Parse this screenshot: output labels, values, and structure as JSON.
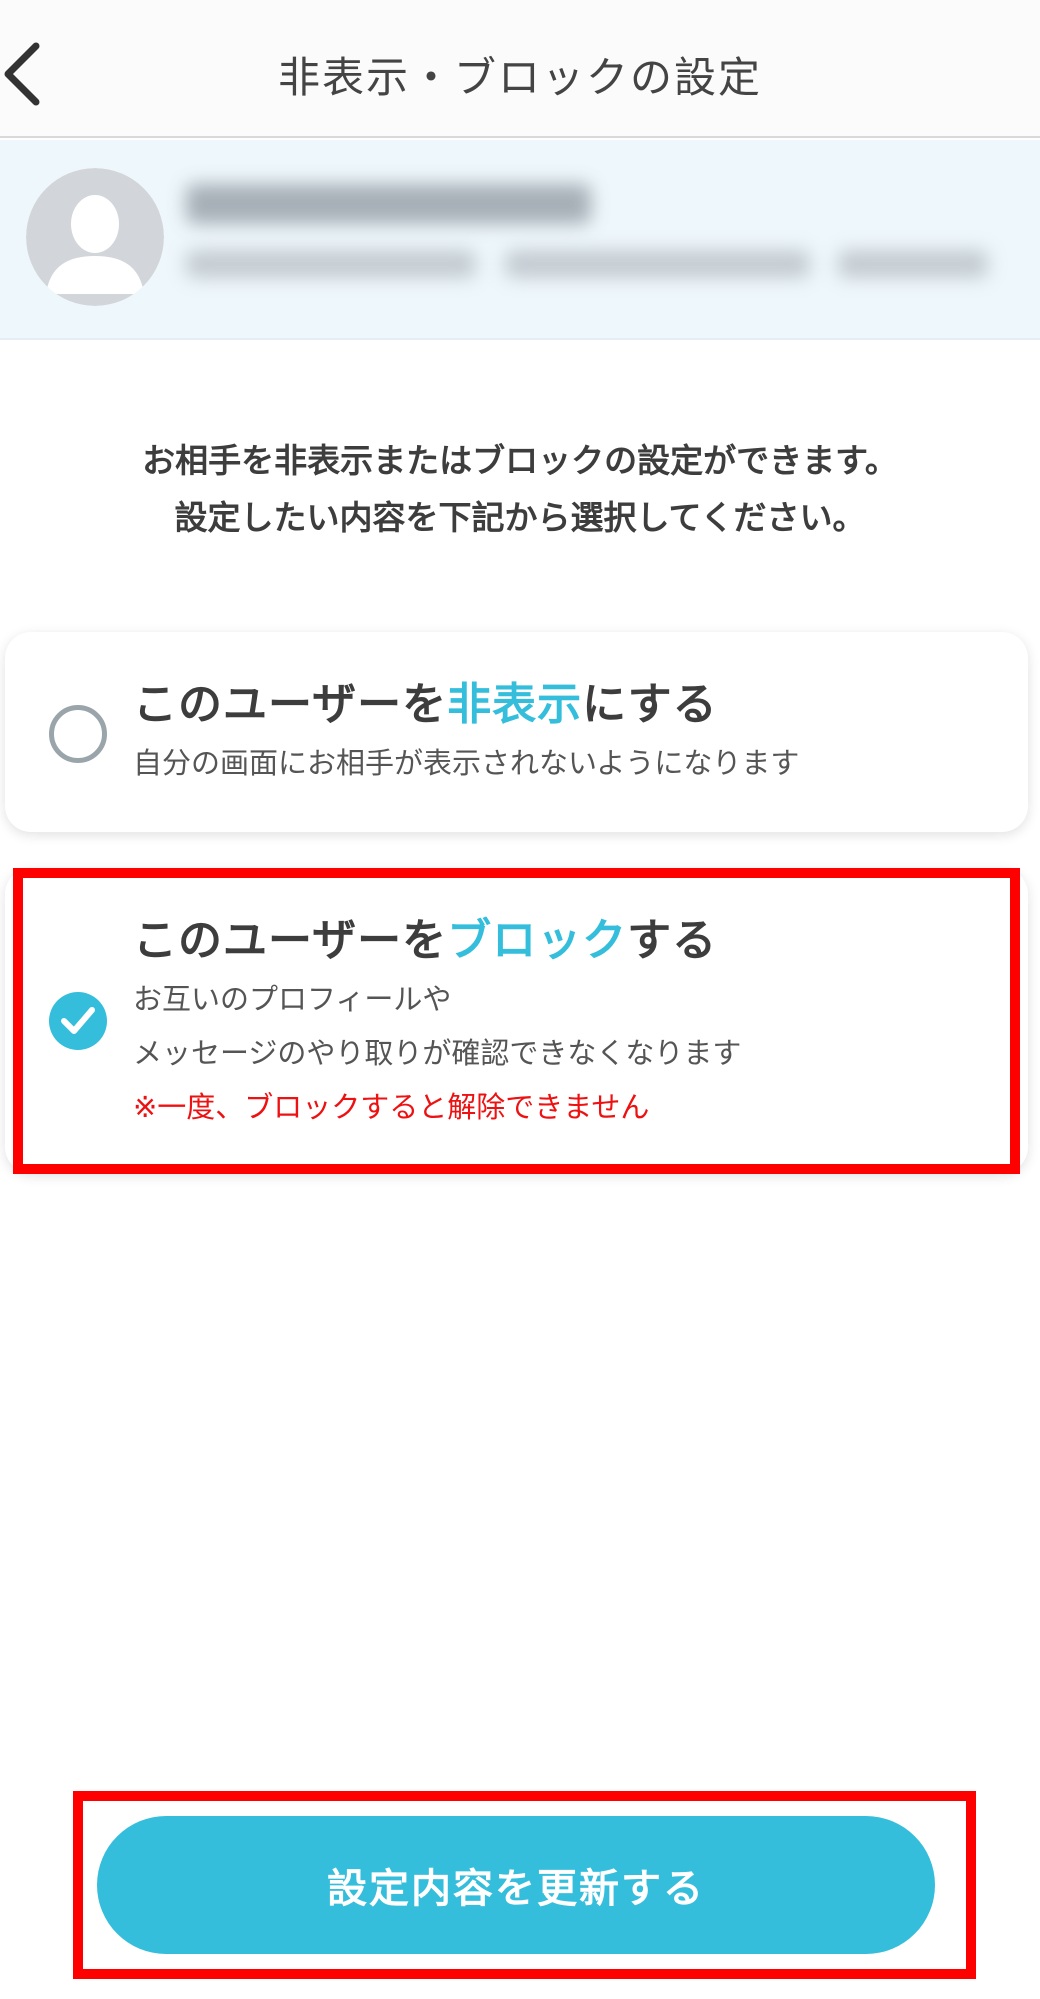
{
  "header": {
    "title": "非表示・ブロックの設定",
    "back_icon": "chevron-left-icon"
  },
  "profile": {
    "avatar_icon": "default-user-avatar"
  },
  "intro": {
    "line1": "お相手を非表示またはブロックの設定ができます。",
    "line2": "設定したい内容を下記から選択してください。"
  },
  "options": [
    {
      "title_prefix": "このユーザーを",
      "title_accent": "非表示",
      "title_suffix": "にする",
      "description": "自分の画面にお相手が表示されないようになります",
      "selected": false
    },
    {
      "title_prefix": "このユーザーを",
      "title_accent": "ブロック",
      "title_suffix": "する",
      "description_line1": "お互いのプロフィールや",
      "description_line2": "メッセージのやり取りが確認できなくなります",
      "warning": "※一度、ブロックすると解除できません",
      "selected": true
    }
  ],
  "submit_label": "設定内容を更新する",
  "colors": {
    "accent": "#35bedc",
    "warning": "#ee1111",
    "highlight": "#ff0000"
  }
}
